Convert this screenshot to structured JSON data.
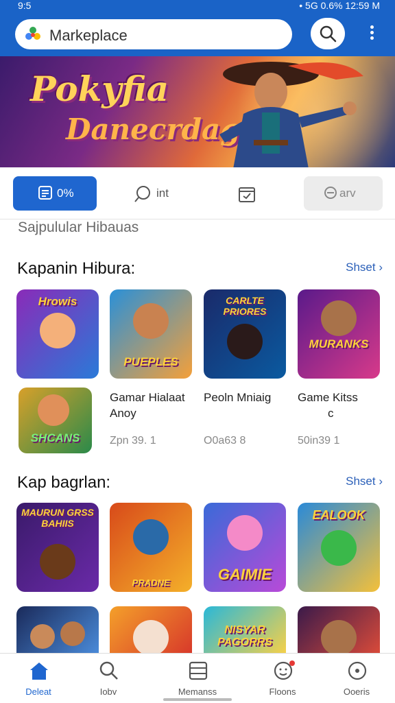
{
  "status": {
    "left": "9:5",
    "right": "• 5G 0.6% 12:59 M"
  },
  "search": {
    "text": "Markeplace"
  },
  "banner": {
    "line1": "Pokyfia",
    "line2": "Danecrdag"
  },
  "tabs": [
    {
      "label": "0%",
      "icon": "list-icon"
    },
    {
      "label": "int",
      "icon": "chat-icon"
    },
    {
      "label": "",
      "icon": "calendar-icon"
    },
    {
      "label": "arv",
      "icon": "minus-circle-icon"
    }
  ],
  "subtitle": "Sajpulular Hibauas",
  "sections": [
    {
      "title": "Kapanin Hibura:",
      "see_all": "Shset",
      "tiles": [
        "Hrowis",
        "PUEPLES",
        "CARLTE PRIORES",
        "MURANKS",
        "SHCANS"
      ],
      "items": [
        {
          "name_line1": "Gamar Hialaat",
          "name_line2": "Anoy",
          "meta": "Zpn 39. 1"
        },
        {
          "name_line1": "Peoln Mniaig",
          "name_line2": "",
          "meta": "O0a63 8"
        },
        {
          "name_line1": "Game Kitss",
          "name_line2": "c",
          "meta": "50in39 1"
        }
      ]
    },
    {
      "title": "Kap bagrlan:",
      "see_all": "Shset",
      "tiles": [
        "MAURUN GRSS BAHIIS",
        "PRADNE",
        "GAIMIE",
        "EALOOK",
        "",
        "",
        "NISYAR PAGORRS",
        ""
      ]
    }
  ],
  "bottom_nav": [
    {
      "label": "Deleat",
      "icon": "home-icon"
    },
    {
      "label": "Iobv",
      "icon": "search-icon"
    },
    {
      "label": "Memanss",
      "icon": "document-icon"
    },
    {
      "label": "Floons",
      "icon": "face-icon"
    },
    {
      "label": "Ooeris",
      "icon": "clock-icon"
    }
  ],
  "colors": {
    "primary": "#1a63c7",
    "accent": "#ffd35a",
    "link": "#2a5fb8"
  }
}
